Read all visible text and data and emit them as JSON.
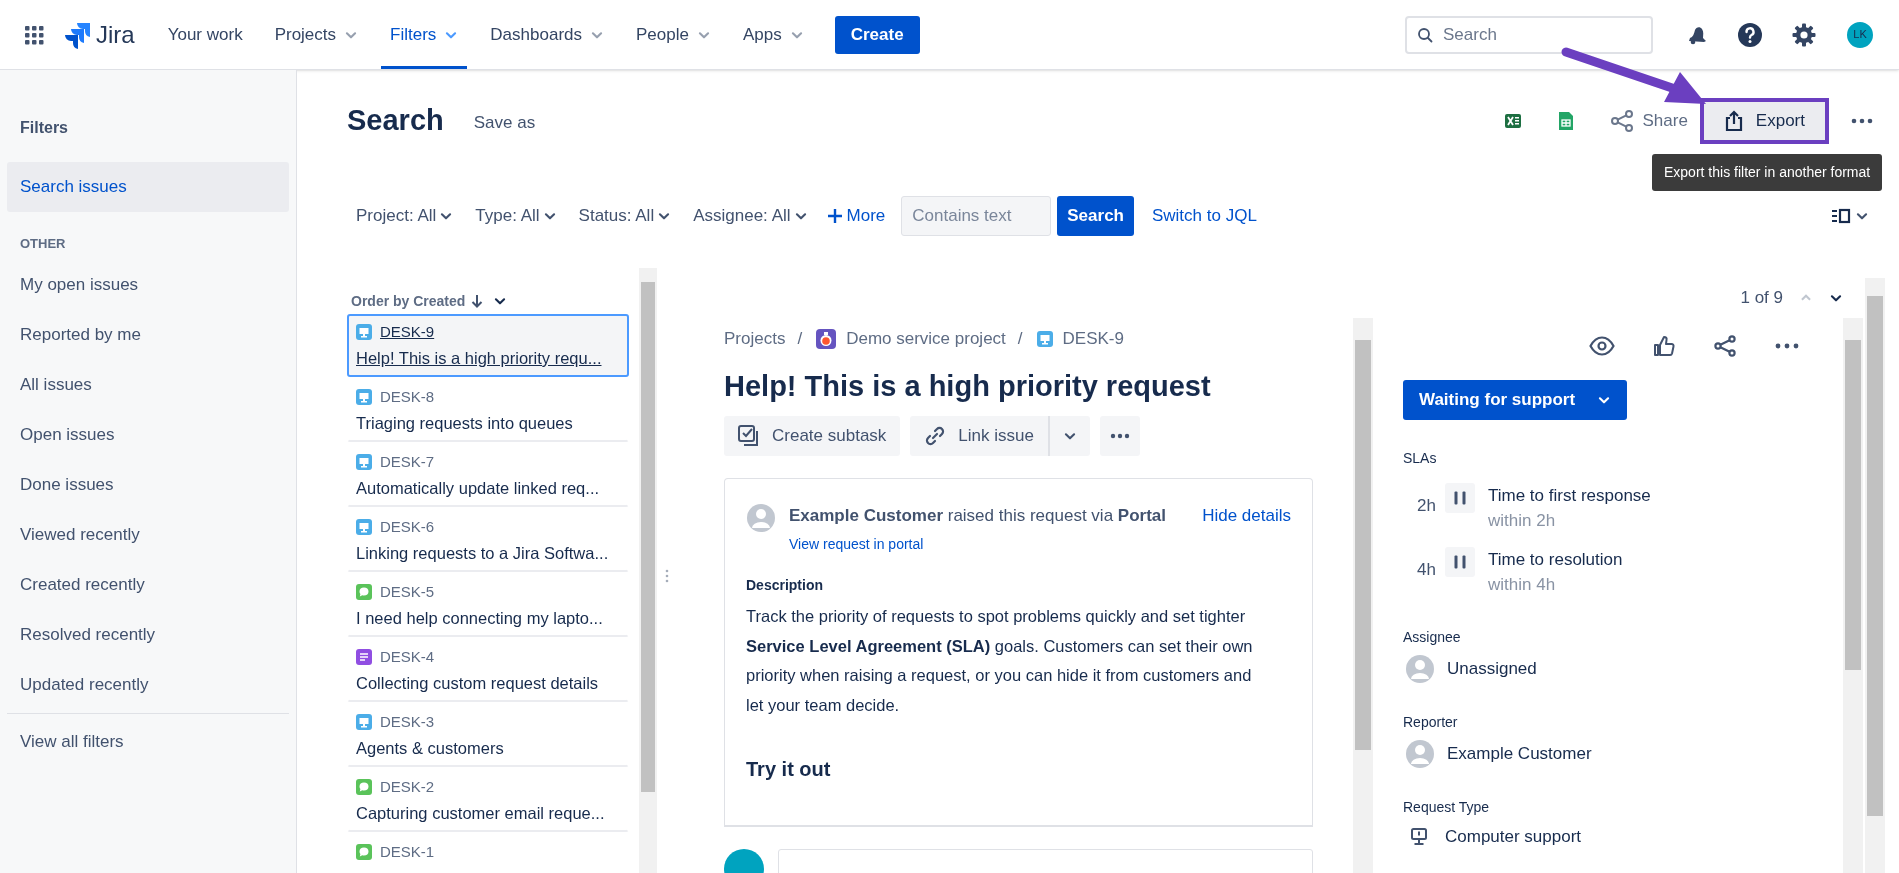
{
  "nav": {
    "logo": "Jira",
    "items": [
      {
        "label": "Your work",
        "dropdown": false,
        "selected": false
      },
      {
        "label": "Projects",
        "dropdown": true,
        "selected": false
      },
      {
        "label": "Filters",
        "dropdown": true,
        "selected": true
      },
      {
        "label": "Dashboards",
        "dropdown": true,
        "selected": false
      },
      {
        "label": "People",
        "dropdown": true,
        "selected": false
      },
      {
        "label": "Apps",
        "dropdown": true,
        "selected": false
      }
    ],
    "create": "Create",
    "search_placeholder": "Search",
    "avatar": "LK"
  },
  "sidebar": {
    "title": "Filters",
    "items": [
      {
        "label": "Search issues",
        "selected": true
      }
    ],
    "section": "OTHER",
    "other_items": [
      {
        "label": "My open issues",
        "selected": false
      },
      {
        "label": "Reported by me",
        "selected": false
      },
      {
        "label": "All issues",
        "selected": false
      },
      {
        "label": "Open issues",
        "selected": false
      },
      {
        "label": "Done issues",
        "selected": false
      },
      {
        "label": "Viewed recently",
        "selected": false
      },
      {
        "label": "Created recently",
        "selected": false
      },
      {
        "label": "Resolved recently",
        "selected": false
      },
      {
        "label": "Updated recently",
        "selected": false
      }
    ],
    "footer": "View all filters"
  },
  "header": {
    "title": "Search",
    "save_as": "Save as",
    "share": "Share",
    "export": "Export",
    "tooltip": "Export this filter in another format"
  },
  "filters": {
    "dropdowns": [
      "Project: All",
      "Type: All",
      "Status: All",
      "Assignee: All"
    ],
    "more": "More",
    "text_placeholder": "Contains text",
    "search_button": "Search",
    "switch": "Switch to JQL"
  },
  "issue_list": {
    "order": "Order by Created",
    "issues": [
      {
        "key": "DESK-9",
        "summary": "Help! This is a high priority requ...",
        "kind": "computer",
        "selected": true
      },
      {
        "key": "DESK-8",
        "summary": "Triaging requests into queues",
        "kind": "computer",
        "selected": false
      },
      {
        "key": "DESK-7",
        "summary": "Automatically update linked req...",
        "kind": "computer",
        "selected": false
      },
      {
        "key": "DESK-6",
        "summary": "Linking requests to a Jira Softwa...",
        "kind": "computer",
        "selected": false
      },
      {
        "key": "DESK-5",
        "summary": "I need help connecting my lapto...",
        "kind": "chat",
        "selected": false
      },
      {
        "key": "DESK-4",
        "summary": "Collecting custom request details",
        "kind": "form",
        "selected": false
      },
      {
        "key": "DESK-3",
        "summary": "Agents & customers",
        "kind": "computer",
        "selected": false
      },
      {
        "key": "DESK-2",
        "summary": "Capturing customer email reque...",
        "kind": "chat",
        "selected": false
      },
      {
        "key": "DESK-1",
        "kind": "chat",
        "selected": false
      }
    ]
  },
  "pager": "1 of 9",
  "issue": {
    "breadcrumbs": [
      "Projects",
      "Demo service project",
      "DESK-9"
    ],
    "title": "Help! This is a high priority request",
    "actions": [
      "Create subtask",
      "Link issue"
    ],
    "request_line": "**Example Customer** raised this request via **Portal**",
    "hide": "Hide details",
    "portal_link": "View request in portal",
    "description_label": "Description",
    "description": "Track the priority of requests to spot problems quickly and set tighter **Service Level Agreement (SLA)** goals. Customers can set their own priority when raising a request, or you can hide it from customers and let your team decide.",
    "subheading": "Try it out",
    "breadcrumb_separator": "/",
    "status": "Waiting for support",
    "slas_label": "SLAs",
    "slas": [
      {
        "remaining": "2h",
        "name": "Time to first response",
        "target": "within 2h"
      },
      {
        "remaining": "4h",
        "name": "Time to resolution",
        "target": "within 4h"
      }
    ],
    "fields": [
      {
        "label": "Assignee",
        "value": "Unassigned",
        "kind": "person"
      },
      {
        "label": "Reporter",
        "value": "Example Customer",
        "kind": "person"
      },
      {
        "label": "Request Type",
        "value": "Computer support",
        "kind": "request-type"
      }
    ]
  }
}
